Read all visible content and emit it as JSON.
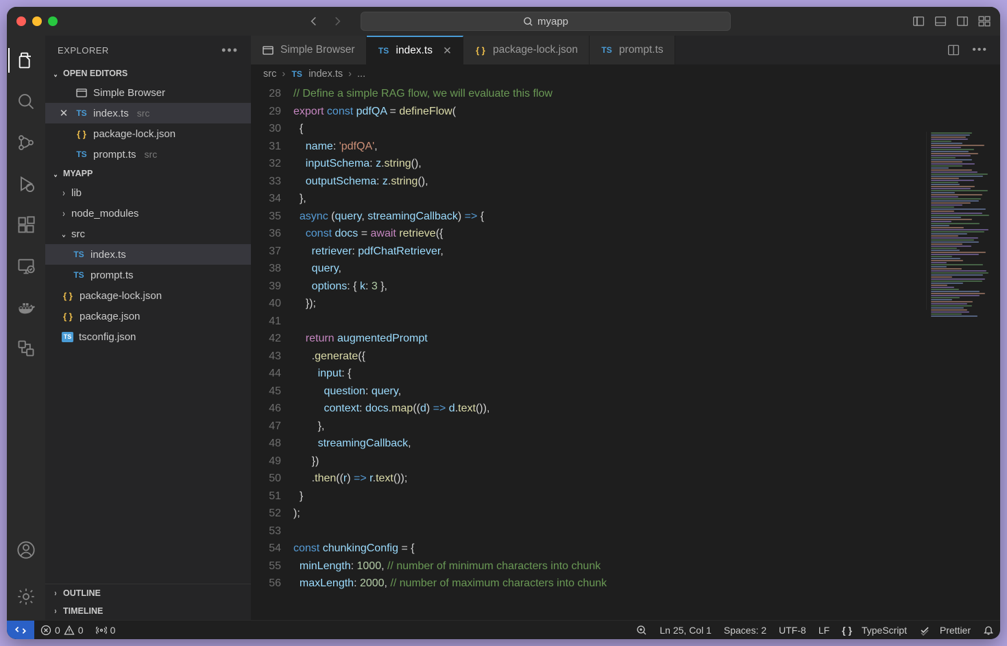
{
  "title_search": "myapp",
  "explorer": {
    "title": "EXPLORER"
  },
  "open_editors": {
    "label": "OPEN EDITORS",
    "items": [
      {
        "name": "Simple Browser",
        "icon": "browser"
      },
      {
        "name": "index.ts",
        "icon": "ts",
        "desc": "src",
        "active": true,
        "close": true
      },
      {
        "name": "package-lock.json",
        "icon": "json"
      },
      {
        "name": "prompt.ts",
        "icon": "ts",
        "desc": "src"
      }
    ]
  },
  "folder": {
    "label": "MYAPP",
    "tree": [
      {
        "type": "folder",
        "name": "lib",
        "depth": 1,
        "open": false
      },
      {
        "type": "folder",
        "name": "node_modules",
        "depth": 1,
        "open": false
      },
      {
        "type": "folder",
        "name": "src",
        "depth": 1,
        "open": true
      },
      {
        "type": "file",
        "name": "index.ts",
        "icon": "ts",
        "depth": 2,
        "sel": true
      },
      {
        "type": "file",
        "name": "prompt.ts",
        "icon": "ts",
        "depth": 2
      },
      {
        "type": "file",
        "name": "package-lock.json",
        "icon": "json",
        "depth": 1
      },
      {
        "type": "file",
        "name": "package.json",
        "icon": "json",
        "depth": 1
      },
      {
        "type": "file",
        "name": "tsconfig.json",
        "icon": "tsjson",
        "depth": 1
      }
    ]
  },
  "outline": "OUTLINE",
  "timeline": "TIMELINE",
  "tabs": [
    {
      "label": "Simple Browser",
      "icon": "browser"
    },
    {
      "label": "index.ts",
      "icon": "ts",
      "active": true,
      "close": true
    },
    {
      "label": "package-lock.json",
      "icon": "json"
    },
    {
      "label": "prompt.ts",
      "icon": "ts"
    }
  ],
  "breadcrumb": [
    "src",
    "index.ts",
    "..."
  ],
  "code_start_line": 28,
  "code": [
    [
      {
        "t": "// Define a simple RAG flow, we will evaluate this flow",
        "c": "cm"
      }
    ],
    [
      {
        "t": "export",
        "c": "kw"
      },
      {
        "t": " "
      },
      {
        "t": "const",
        "c": "ty"
      },
      {
        "t": " "
      },
      {
        "t": "pdfQA",
        "c": "var"
      },
      {
        "t": " = "
      },
      {
        "t": "defineFlow",
        "c": "fn"
      },
      {
        "t": "("
      }
    ],
    [
      {
        "t": "  {"
      }
    ],
    [
      {
        "t": "    "
      },
      {
        "t": "name",
        "c": "var"
      },
      {
        "t": ": "
      },
      {
        "t": "'pdfQA'",
        "c": "str"
      },
      {
        "t": ","
      }
    ],
    [
      {
        "t": "    "
      },
      {
        "t": "inputSchema",
        "c": "var"
      },
      {
        "t": ": "
      },
      {
        "t": "z",
        "c": "var"
      },
      {
        "t": "."
      },
      {
        "t": "string",
        "c": "fn"
      },
      {
        "t": "(),"
      }
    ],
    [
      {
        "t": "    "
      },
      {
        "t": "outputSchema",
        "c": "var"
      },
      {
        "t": ": "
      },
      {
        "t": "z",
        "c": "var"
      },
      {
        "t": "."
      },
      {
        "t": "string",
        "c": "fn"
      },
      {
        "t": "(),"
      }
    ],
    [
      {
        "t": "  },"
      }
    ],
    [
      {
        "t": "  "
      },
      {
        "t": "async",
        "c": "ty"
      },
      {
        "t": " ("
      },
      {
        "t": "query",
        "c": "var"
      },
      {
        "t": ", "
      },
      {
        "t": "streamingCallback",
        "c": "var"
      },
      {
        "t": ") "
      },
      {
        "t": "=>",
        "c": "ty"
      },
      {
        "t": " {"
      }
    ],
    [
      {
        "t": "    "
      },
      {
        "t": "const",
        "c": "ty"
      },
      {
        "t": " "
      },
      {
        "t": "docs",
        "c": "var"
      },
      {
        "t": " = "
      },
      {
        "t": "await",
        "c": "kw"
      },
      {
        "t": " "
      },
      {
        "t": "retrieve",
        "c": "fn"
      },
      {
        "t": "({"
      }
    ],
    [
      {
        "t": "      "
      },
      {
        "t": "retriever",
        "c": "var"
      },
      {
        "t": ": "
      },
      {
        "t": "pdfChatRetriever",
        "c": "var"
      },
      {
        "t": ","
      }
    ],
    [
      {
        "t": "      "
      },
      {
        "t": "query",
        "c": "var"
      },
      {
        "t": ","
      }
    ],
    [
      {
        "t": "      "
      },
      {
        "t": "options",
        "c": "var"
      },
      {
        "t": ": { "
      },
      {
        "t": "k",
        "c": "var"
      },
      {
        "t": ": "
      },
      {
        "t": "3",
        "c": "num"
      },
      {
        "t": " },"
      }
    ],
    [
      {
        "t": "    });"
      }
    ],
    [
      {
        "t": ""
      }
    ],
    [
      {
        "t": "    "
      },
      {
        "t": "return",
        "c": "kw"
      },
      {
        "t": " "
      },
      {
        "t": "augmentedPrompt",
        "c": "var"
      }
    ],
    [
      {
        "t": "      ."
      },
      {
        "t": "generate",
        "c": "fn"
      },
      {
        "t": "({"
      }
    ],
    [
      {
        "t": "        "
      },
      {
        "t": "input",
        "c": "var"
      },
      {
        "t": ": {"
      }
    ],
    [
      {
        "t": "          "
      },
      {
        "t": "question",
        "c": "var"
      },
      {
        "t": ": "
      },
      {
        "t": "query",
        "c": "var"
      },
      {
        "t": ","
      }
    ],
    [
      {
        "t": "          "
      },
      {
        "t": "context",
        "c": "var"
      },
      {
        "t": ": "
      },
      {
        "t": "docs",
        "c": "var"
      },
      {
        "t": "."
      },
      {
        "t": "map",
        "c": "fn"
      },
      {
        "t": "(("
      },
      {
        "t": "d",
        "c": "var"
      },
      {
        "t": ") "
      },
      {
        "t": "=>",
        "c": "ty"
      },
      {
        "t": " "
      },
      {
        "t": "d",
        "c": "var"
      },
      {
        "t": "."
      },
      {
        "t": "text",
        "c": "fn"
      },
      {
        "t": "()),"
      }
    ],
    [
      {
        "t": "        },"
      }
    ],
    [
      {
        "t": "        "
      },
      {
        "t": "streamingCallback",
        "c": "var"
      },
      {
        "t": ","
      }
    ],
    [
      {
        "t": "      })"
      }
    ],
    [
      {
        "t": "      ."
      },
      {
        "t": "then",
        "c": "fn"
      },
      {
        "t": "(("
      },
      {
        "t": "r",
        "c": "var"
      },
      {
        "t": ") "
      },
      {
        "t": "=>",
        "c": "ty"
      },
      {
        "t": " "
      },
      {
        "t": "r",
        "c": "var"
      },
      {
        "t": "."
      },
      {
        "t": "text",
        "c": "fn"
      },
      {
        "t": "());"
      }
    ],
    [
      {
        "t": "  }"
      }
    ],
    [
      {
        "t": ");"
      }
    ],
    [
      {
        "t": ""
      }
    ],
    [
      {
        "t": "const",
        "c": "ty"
      },
      {
        "t": " "
      },
      {
        "t": "chunkingConfig",
        "c": "var"
      },
      {
        "t": " = {"
      }
    ],
    [
      {
        "t": "  "
      },
      {
        "t": "minLength",
        "c": "var"
      },
      {
        "t": ": "
      },
      {
        "t": "1000",
        "c": "num"
      },
      {
        "t": ", "
      },
      {
        "t": "// number of minimum characters into chunk",
        "c": "cm"
      }
    ],
    [
      {
        "t": "  "
      },
      {
        "t": "maxLength",
        "c": "var"
      },
      {
        "t": ": "
      },
      {
        "t": "2000",
        "c": "num"
      },
      {
        "t": ", "
      },
      {
        "t": "// number of maximum characters into chunk",
        "c": "cm"
      }
    ]
  ],
  "status": {
    "errors": "0",
    "warnings": "0",
    "ports": "0",
    "pos": "Ln 25, Col 1",
    "spaces": "Spaces: 2",
    "enc": "UTF-8",
    "eol": "LF",
    "lang": "TypeScript",
    "prettier": "Prettier"
  }
}
